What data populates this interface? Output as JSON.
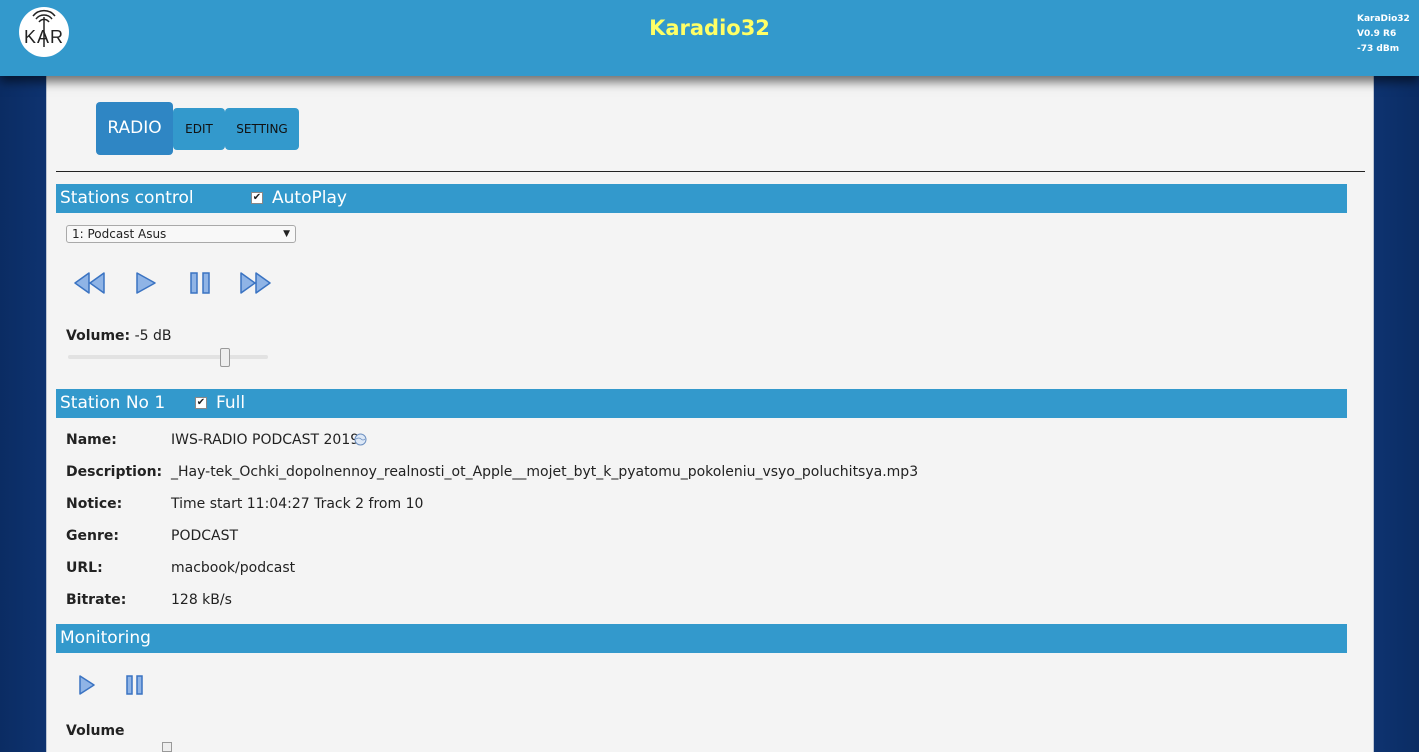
{
  "header": {
    "logo_text": "KAR",
    "title": "Karadio32",
    "info": [
      "KaraDio32",
      "V0.9 R6",
      "-73 dBm"
    ]
  },
  "tabs": [
    "RADIO",
    "EDIT",
    "SETTING"
  ],
  "stations_control": {
    "title": "Stations control",
    "autoplay_label": "AutoPlay",
    "autoplay_checked": true,
    "selected_station": "1: Podcast Asus",
    "volume_label": "Volume:",
    "volume_value": "-5 dB",
    "volume_slider_fraction": 0.8,
    "icons": [
      "rewind-icon",
      "play-icon",
      "pause-icon",
      "fast-forward-icon"
    ]
  },
  "station": {
    "title": "Station No 1",
    "full_label": "Full",
    "full_checked": true,
    "fields": [
      {
        "label": "Name:",
        "value": "IWS-RADIO PODCAST 2019"
      },
      {
        "label": "Description:",
        "value": "_Hay-tek_Ochki_dopolnennoy_realnosti_ot_Apple__mojet_byt_k_pyatomu_pokoleniu_vsyo_poluchitsya.mp3"
      },
      {
        "label": "Notice:",
        "value": "Time start 11:04:27 Track 2 from 10"
      },
      {
        "label": "Genre:",
        "value": "PODCAST"
      },
      {
        "label": "URL:",
        "value": "macbook/podcast"
      },
      {
        "label": "Bitrate:",
        "value": "128 kB/s"
      }
    ]
  },
  "monitoring": {
    "title": "Monitoring",
    "volume_label": "Volume",
    "icons": [
      "play-icon",
      "pause-icon"
    ]
  },
  "colors": {
    "header_bg": "#3399cc",
    "title_color": "#ffff66",
    "active_tab": "#2f86c4",
    "icon_fill": "#8fb4e6",
    "side_bg": "#0e3370"
  }
}
